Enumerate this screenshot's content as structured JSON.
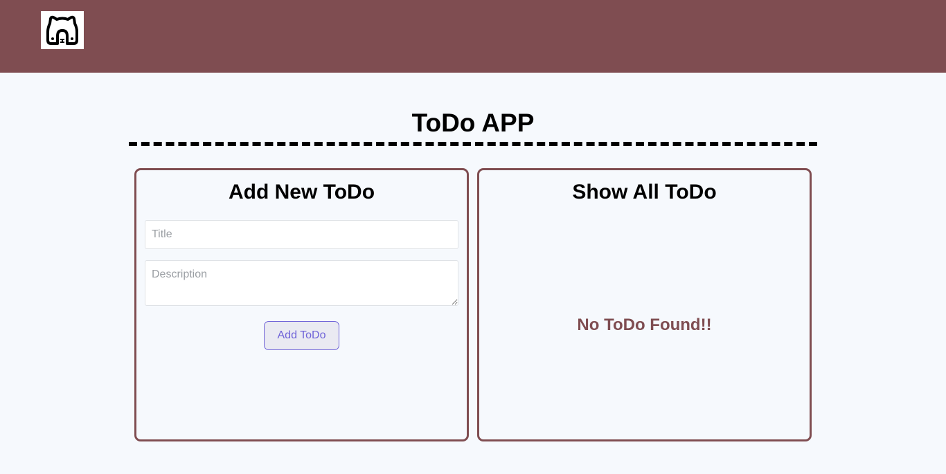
{
  "colors": {
    "navbar": "#7f4d51",
    "background": "#f6f9fd",
    "panel_border": "#7f4d51",
    "button_accent": "#6f63d8",
    "empty_text": "#7f4d51"
  },
  "header": {
    "logo_icon": "bear-face-logo-icon"
  },
  "main": {
    "title": "ToDo APP"
  },
  "add_panel": {
    "heading": "Add New ToDo",
    "title_input": {
      "placeholder": "Title",
      "value": ""
    },
    "description_input": {
      "placeholder": "Description",
      "value": ""
    },
    "add_button_label": "Add ToDo"
  },
  "list_panel": {
    "heading": "Show All ToDo",
    "empty_message": "No ToDo Found!!"
  }
}
